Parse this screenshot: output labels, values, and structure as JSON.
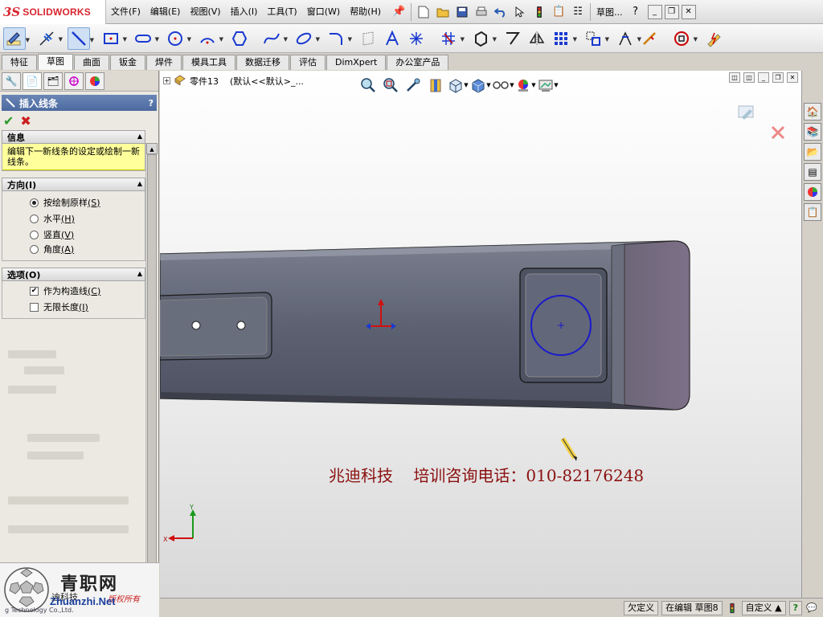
{
  "app": {
    "brand_ds": "3S",
    "brand_name": "SOLIDWORKS"
  },
  "menu": {
    "items": [
      "文件(F)",
      "编辑(E)",
      "视图(V)",
      "插入(I)",
      "工具(T)",
      "窗口(W)",
      "帮助(H)"
    ],
    "sketch_menu": "草图...",
    "help_icon": "?"
  },
  "tabs": [
    "特征",
    "草图",
    "曲面",
    "钣金",
    "焊件",
    "模具工具",
    "数据迁移",
    "评估",
    "DimXpert",
    "办公室产品"
  ],
  "active_tab": "草图",
  "property_manager": {
    "title": "插入线条",
    "help": "?",
    "info": {
      "heading": "信息",
      "text": "编辑下一新线条的设定或绘制一新线条。"
    },
    "orientation": {
      "heading": "方向(I)",
      "options": [
        {
          "label": "按绘制原样",
          "key": "(S)",
          "selected": true
        },
        {
          "label": "水平",
          "key": "(H)",
          "selected": false
        },
        {
          "label": "竖直",
          "key": "(V)",
          "selected": false
        },
        {
          "label": "角度",
          "key": "(A)",
          "selected": false
        }
      ]
    },
    "options": {
      "heading": "选项(O)",
      "items": [
        {
          "label": "作为构造线",
          "key": "(C)",
          "checked": true
        },
        {
          "label": "无限长度",
          "key": "(I)",
          "checked": false
        }
      ]
    }
  },
  "feature_tree": {
    "part_name": "零件13",
    "config": "(默认<<默认>_..."
  },
  "graphics": {
    "overlay_text": "兆迪科技    培训咨询电话：010-82176248",
    "triad_x": "X",
    "triad_y": "Y"
  },
  "status_bar": {
    "under_defined": "欠定义",
    "editing": "在编辑 草图8",
    "custom": "自定义",
    "help": "?"
  },
  "corner_logo": {
    "name": "青职网",
    "company": "迪科技",
    "url": "Zhuanzhi.Net",
    "tagline": "g Technology Co.,Ltd.",
    "red_tag": "版权所有"
  },
  "colors": {
    "sketch_circle": "#1a1acc",
    "part_body": "#5c6170",
    "title_blue": "#4c6aa0",
    "info_yellow": "#ffff9c",
    "overlay_text": "#8b1010"
  }
}
